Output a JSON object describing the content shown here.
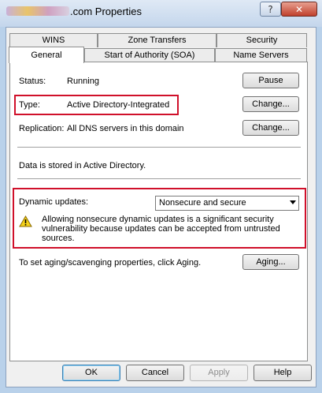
{
  "window": {
    "title": ".com Properties",
    "help_glyph": "?",
    "close_glyph": "✕"
  },
  "tabs": {
    "row1": [
      "WINS",
      "Zone Transfers",
      "Security"
    ],
    "row2": [
      "General",
      "Start of Authority (SOA)",
      "Name Servers"
    ]
  },
  "general": {
    "status_label": "Status:",
    "status_value": "Running",
    "pause_label": "Pause",
    "type_label": "Type:",
    "type_value": "Active Directory-Integrated",
    "change_label": "Change...",
    "replication_label": "Replication:",
    "replication_value": "All DNS servers in this domain",
    "stored_text": "Data is stored in Active Directory.",
    "dynamic_label": "Dynamic updates:",
    "dynamic_selected": "Nonsecure and secure",
    "warning_text": "Allowing nonsecure dynamic updates is a significant security vulnerability because updates can be accepted from untrusted sources.",
    "aging_text": "To set aging/scavenging properties, click Aging.",
    "aging_label": "Aging..."
  },
  "footer": {
    "ok_label": "OK",
    "cancel_label": "Cancel",
    "apply_label": "Apply",
    "help_label": "Help"
  },
  "colors": {
    "highlight_border": "#d0102a",
    "warning_yellow": "#f5d21a"
  }
}
